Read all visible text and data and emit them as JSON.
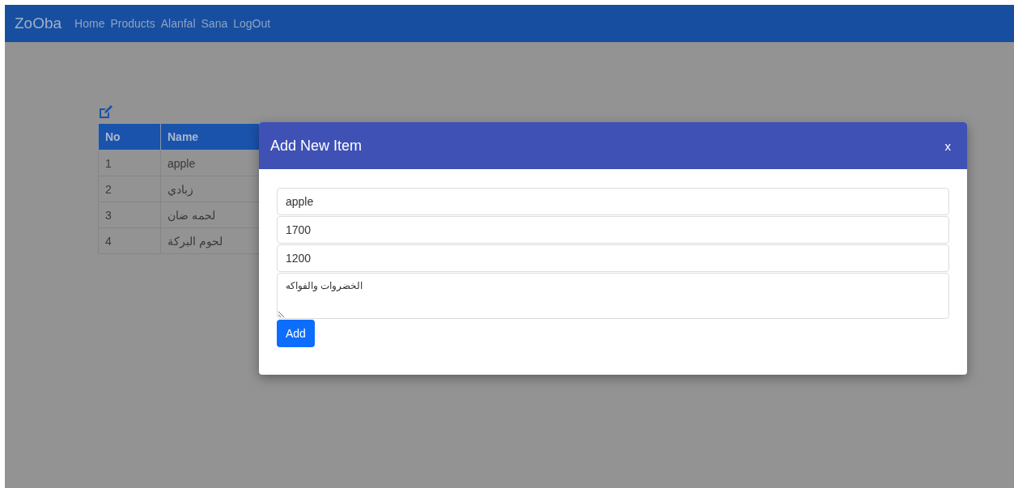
{
  "navbar": {
    "brand": "ZoOba",
    "links": [
      "Home",
      "Products",
      "Alanfal",
      "Sana",
      "LogOut"
    ]
  },
  "table": {
    "columns": [
      "No",
      "Name"
    ],
    "rows": [
      [
        "1",
        "apple"
      ],
      [
        "2",
        "زبادي"
      ],
      [
        "3",
        "لحمه ضان"
      ],
      [
        "4",
        "لحوم البركة"
      ]
    ]
  },
  "modal": {
    "title": "Add New Item",
    "close": "x",
    "fields": [
      {
        "kind": "input",
        "value": "apple"
      },
      {
        "kind": "input",
        "value": "1700"
      },
      {
        "kind": "input",
        "value": "1200"
      },
      {
        "kind": "textarea",
        "value": "الخضروات والفواكه"
      }
    ],
    "button": "Add"
  }
}
